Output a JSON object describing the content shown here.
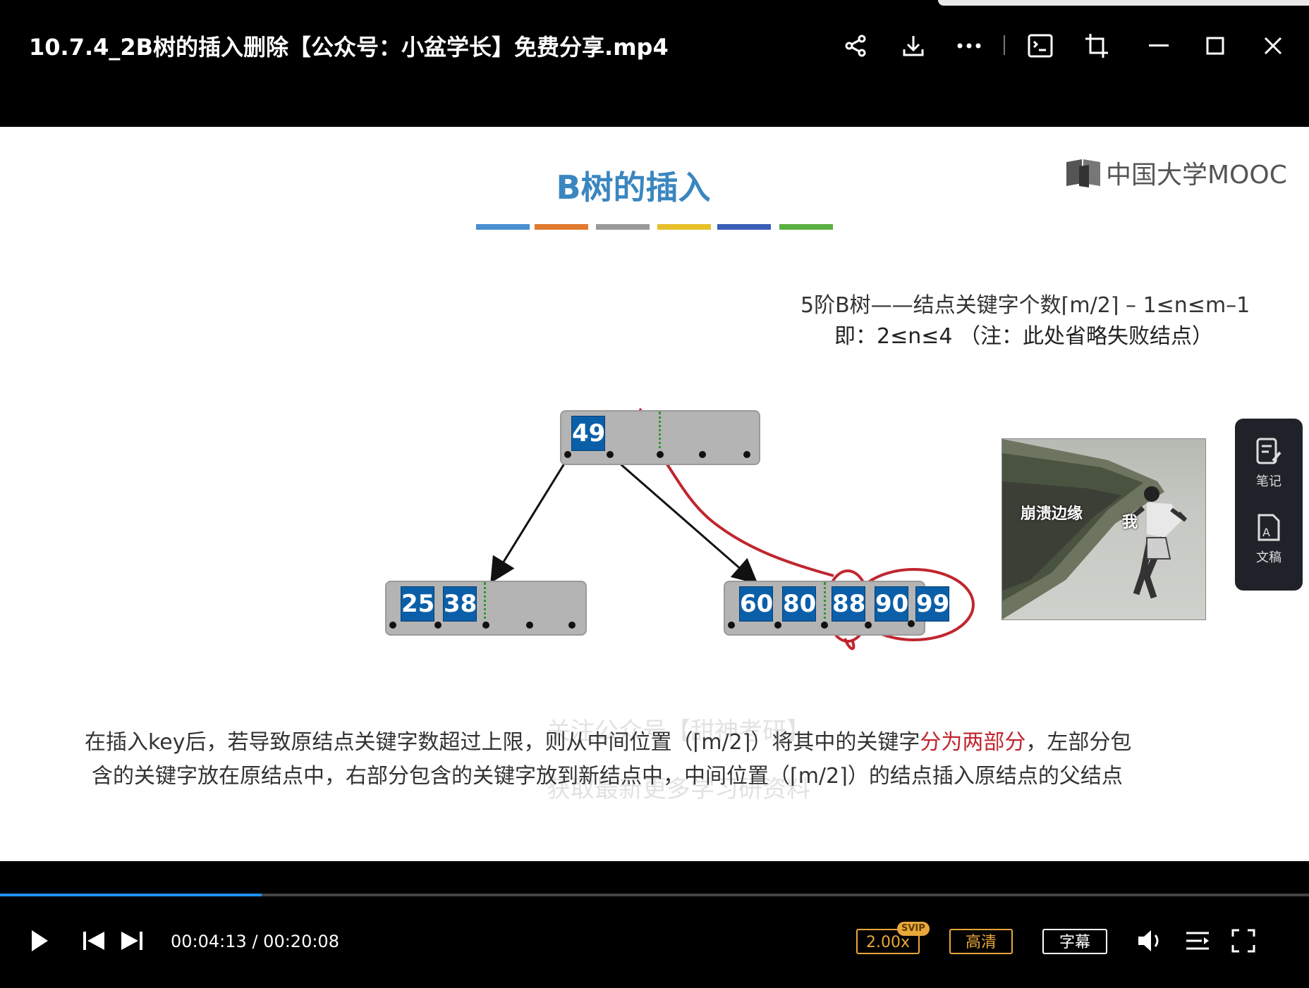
{
  "window": {
    "title": "10.7.4_2B树的插入删除【公众号：小盆学长】免费分享.mp4"
  },
  "toolbar": {
    "icons": [
      "share-icon",
      "download-icon",
      "more-icon",
      "screenshot-icon",
      "crop-icon",
      "minimize-icon",
      "maximize-icon",
      "close-icon"
    ]
  },
  "slide": {
    "title": "B树的插入",
    "title_color": "#3a86c0",
    "color_bars": [
      "#4a8fd0",
      "#e07a2e",
      "#9a9a9a",
      "#e6c02a",
      "#3a5fb8",
      "#5ab040"
    ],
    "logo": "中国大学MOOC",
    "formula_line1": "5阶B树——结点关键字个数⌈m/2⌉ – 1≤n≤m–1",
    "formula_line2": "即：2≤n≤4 （注：此处省略失败结点）",
    "root_keys": [
      "49"
    ],
    "left_child_keys": [
      "25",
      "38"
    ],
    "right_child_keys": [
      "60",
      "80",
      "88",
      "90",
      "99"
    ],
    "key_color": "#0b5fa8",
    "annotation_color": "#c0262e",
    "meme_text1": "崩溃边缘",
    "meme_text2": "我",
    "text_line1_a": "在插入key后，若导致原结点关键字数超过上限，则从中间位置（⌈m/2⌉）将其中的关键字",
    "text_line1_hl": "分为两部分",
    "text_line1_b": "，左部分包",
    "text_line2": "含的关键字放在原结点中，右部分包含的关键字放到新结点中，中间位置（⌈m/2⌉）的结点插入原结点的父结点",
    "watermark1": "关注公众号【甜神考研】",
    "watermark2": "获取最新更多学习研资料"
  },
  "side_panel": {
    "notes_label": "笔记",
    "transcript_label": "文稿"
  },
  "player": {
    "progress": 0.2,
    "current_time": "00:04:13",
    "time_separator": "/",
    "total_time": "00:20:08",
    "speed": "2.00x",
    "svip_badge": "SVIP",
    "quality": "高清",
    "subtitles": "字幕",
    "accent_color": "#1e90ff"
  }
}
